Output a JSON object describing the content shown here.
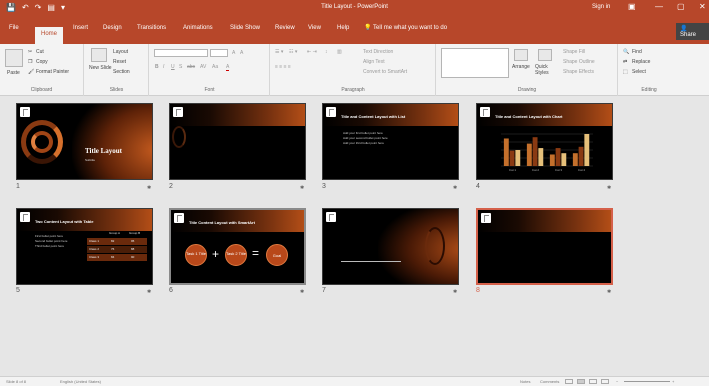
{
  "titlebar": {
    "title": "Title Layout - PowerPoint",
    "sign_in": "Sign in",
    "qat": [
      "💾",
      "↶",
      "↷",
      "▤",
      "▾"
    ],
    "window_buttons": [
      "▣",
      "—",
      "▢",
      "✕"
    ]
  },
  "tabs": {
    "items": [
      "File",
      "Home",
      "Insert",
      "Design",
      "Transitions",
      "Animations",
      "Slide Show",
      "Review",
      "View",
      "Help"
    ],
    "active": "Home",
    "tell_me": "Tell me what you want to do",
    "share": "Share"
  },
  "ribbon": {
    "clipboard": {
      "label": "Clipboard",
      "paste": "Paste",
      "cut": "Cut",
      "copy": "Copy",
      "format_painter": "Format Painter"
    },
    "slides": {
      "label": "Slides",
      "new_slide": "New Slide",
      "layout": "Layout",
      "reset": "Reset",
      "section": "Section"
    },
    "font": {
      "label": "Font",
      "font_name": "",
      "font_size": "",
      "bold": "B",
      "italic": "I",
      "underline": "U",
      "shadow": "S",
      "strike": "abc",
      "spacing": "AV",
      "case": "Aa",
      "color": "A",
      "grow": "A",
      "shrink": "A"
    },
    "paragraph": {
      "label": "Paragraph",
      "text_direction": "Text Direction",
      "align_text": "Align Text",
      "convert_smartart": "Convert to SmartArt"
    },
    "drawing": {
      "label": "Drawing",
      "arrange": "Arrange",
      "quick_styles": "Quick Styles",
      "shape_fill": "Shape Fill",
      "shape_outline": "Shape Outline",
      "shape_effects": "Shape Effects"
    },
    "editing": {
      "label": "Editing",
      "find": "Find",
      "replace": "Replace",
      "select": "Select"
    }
  },
  "slides": [
    {
      "number": "1",
      "title": "Title Layout",
      "subtitle": "Subtitle"
    },
    {
      "number": "2",
      "title": ""
    },
    {
      "number": "3",
      "title": "Title and Content Layout with List",
      "bullets": [
        "Add your first bullet point here",
        "Add your second bullet point here",
        "Add your third bullet point here"
      ]
    },
    {
      "number": "4",
      "title": "Title and Content Layout with Chart",
      "chart_values": [
        4.3,
        2.4,
        2.5,
        3.5,
        4.5,
        2.8,
        1.8,
        2.8,
        2,
        2,
        3,
        5
      ],
      "x_labels": [
        "Cat 1",
        "Cat 2",
        "Cat 3",
        "Cat 4"
      ]
    },
    {
      "number": "5",
      "title": "Two Content Layout with Table",
      "bullets": [
        "First bullet point here",
        "Second bullet point here",
        "Third bullet point here"
      ],
      "table_headers": [
        "",
        "Group A",
        "Group B"
      ],
      "table_rows": [
        [
          "Class 1",
          "82",
          "95"
        ],
        [
          "Class 2",
          "76",
          "88"
        ],
        [
          "Class 3",
          "84",
          "90"
        ]
      ]
    },
    {
      "number": "6",
      "title": "Title Content Layout with SmartArt",
      "smartart": [
        "Task 1 Title",
        "Task 2 Title",
        "Goal"
      ],
      "ops": [
        "+",
        "="
      ]
    },
    {
      "number": "7",
      "title": ""
    },
    {
      "number": "8",
      "title": ""
    }
  ],
  "slide_star": "✱",
  "status": {
    "slide_info": "Slide 8 of 8",
    "language": "English (United States)",
    "notes": "Notes",
    "comments": "Comments",
    "zoom": "",
    "zoom_minus": "−",
    "zoom_plus": "+"
  },
  "colors": {
    "accent": "#b7472a",
    "selected_border": "#d5604a",
    "slide_bg": "#000000",
    "slide_accent": "#b34e17"
  }
}
